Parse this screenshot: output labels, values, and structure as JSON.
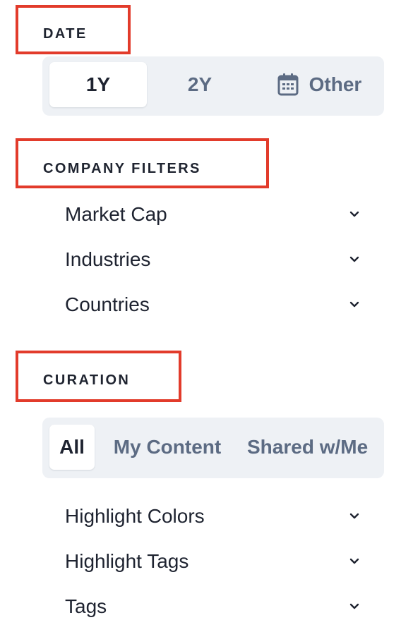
{
  "date_section": {
    "title": "DATE",
    "options": [
      {
        "label": "1Y",
        "active": true
      },
      {
        "label": "2Y",
        "active": false
      },
      {
        "label": "Other",
        "active": false,
        "icon": "calendar-icon"
      }
    ]
  },
  "company_filters": {
    "title": "COMPANY FILTERS",
    "items": [
      {
        "label": "Market Cap",
        "icon": "chevron-down-icon"
      },
      {
        "label": "Industries",
        "icon": "chevron-down-icon"
      },
      {
        "label": "Countries",
        "icon": "chevron-down-icon"
      }
    ]
  },
  "curation": {
    "title": "CURATION",
    "tabs": [
      {
        "label": "All",
        "active": true
      },
      {
        "label": "My Content",
        "active": false
      },
      {
        "label": "Shared w/Me",
        "active": false
      }
    ],
    "items": [
      {
        "label": "Highlight Colors",
        "icon": "chevron-down-icon"
      },
      {
        "label": "Highlight Tags",
        "icon": "chevron-down-icon"
      },
      {
        "label": "Tags",
        "icon": "chevron-down-icon"
      }
    ]
  },
  "colors": {
    "annotation_red": "#e23b2b",
    "segment_bg": "#eef1f5",
    "inactive_text": "#5c6b83",
    "active_text": "#1e2330"
  }
}
